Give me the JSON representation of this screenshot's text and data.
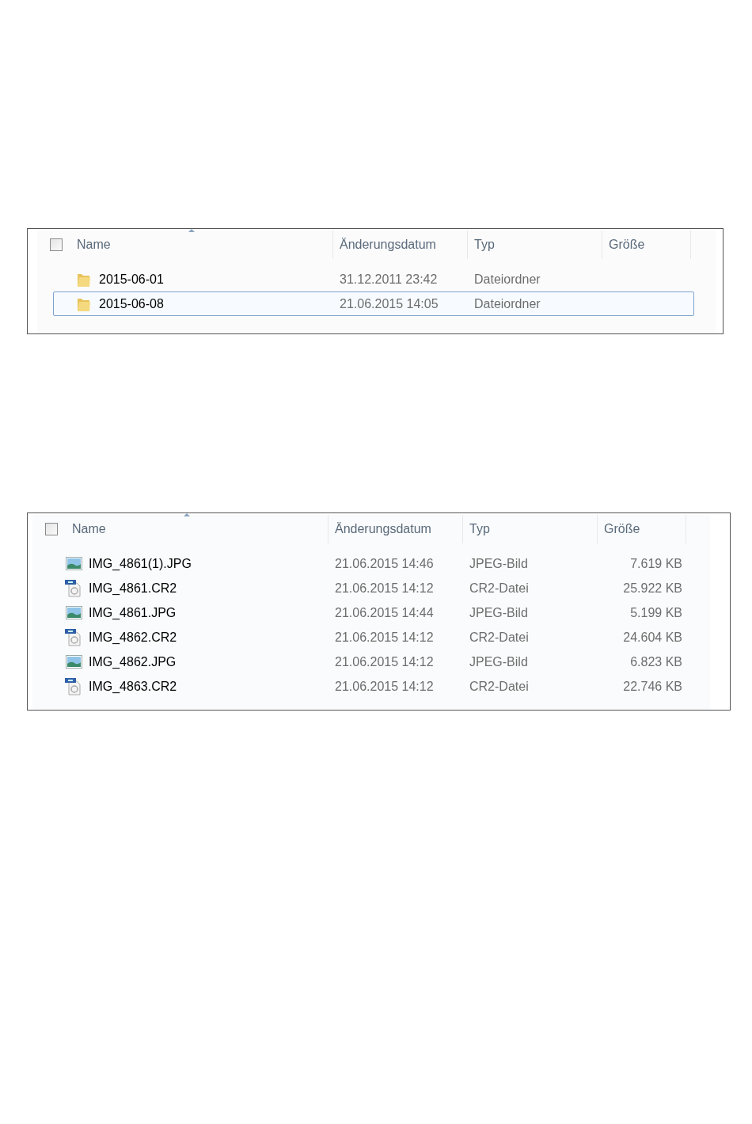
{
  "panels": [
    {
      "header_checkbox": {
        "checked": false
      },
      "columns": [
        "Name",
        "Änderungsdatum",
        "Typ",
        "Größe"
      ],
      "rows": [
        {
          "kind": "folder",
          "name": "2015-06-01",
          "date": "31.12.2011 23:42",
          "type": "Dateiordner",
          "selected": false
        },
        {
          "kind": "folder",
          "name": "2015-06-08",
          "date": "21.06.2015 14:05",
          "type": "Dateiordner",
          "selected": true
        }
      ]
    },
    {
      "header_checkbox": {
        "checked": false
      },
      "columns": [
        "Name",
        "Änderungsdatum",
        "Typ",
        "Größe"
      ],
      "rows": [
        {
          "kind": "image",
          "name": "IMG_4861(1).JPG",
          "date": "21.06.2015 14:46",
          "type": "JPEG-Bild",
          "size": "7.619 KB",
          "selected": false
        },
        {
          "kind": "raw",
          "name": "IMG_4861.CR2",
          "date": "21.06.2015 14:12",
          "type": "CR2-Datei",
          "size": "25.922 KB",
          "selected": false
        },
        {
          "kind": "image",
          "name": "IMG_4861.JPG",
          "date": "21.06.2015 14:44",
          "type": "JPEG-Bild",
          "size": "5.199 KB",
          "selected": false
        },
        {
          "kind": "raw",
          "name": "IMG_4862.CR2",
          "date": "21.06.2015 14:12",
          "type": "CR2-Datei",
          "size": "24.604 KB",
          "selected": false
        },
        {
          "kind": "image",
          "name": "IMG_4862.JPG",
          "date": "21.06.2015 14:12",
          "type": "JPEG-Bild",
          "size": "6.823 KB",
          "selected": false
        },
        {
          "kind": "raw",
          "name": "IMG_4863.CR2",
          "date": "21.06.2015 14:12",
          "type": "CR2-Datei",
          "size": "22.746 KB",
          "selected": false
        }
      ]
    }
  ]
}
